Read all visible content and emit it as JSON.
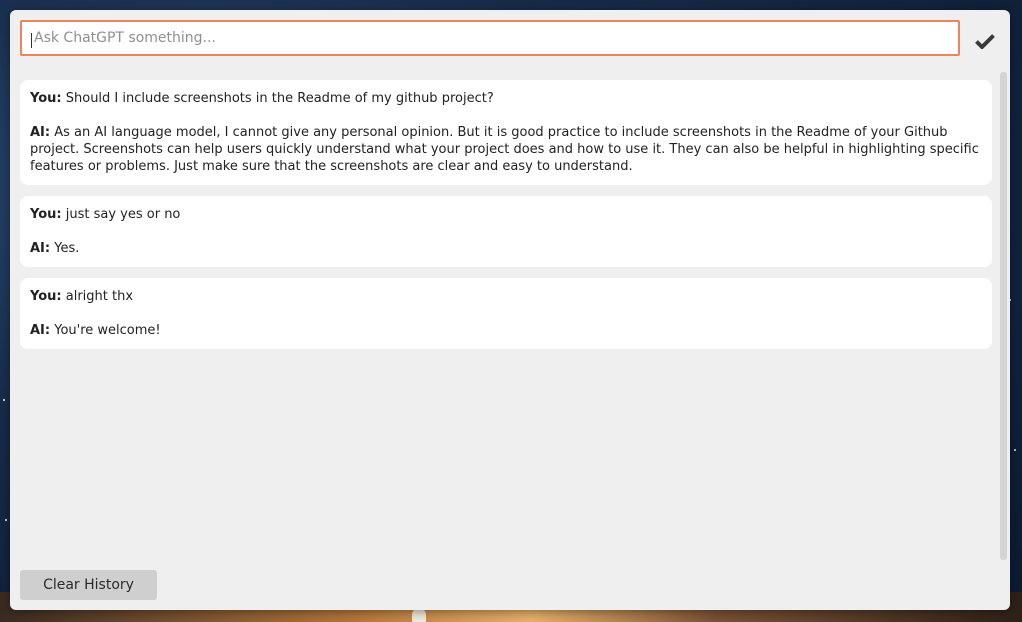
{
  "input": {
    "value": "",
    "placeholder": "Ask ChatGPT something..."
  },
  "submit": {
    "icon": "checkmark-icon"
  },
  "speakers": {
    "user": "You:",
    "ai": "AI:"
  },
  "messages": [
    {
      "user": "Should I include screenshots in the Readme of my github project?",
      "ai": "As an AI language model, I cannot give any personal opinion. But it is good practice to include screenshots in the Readme of your Github project. Screenshots can help users quickly understand what your project does and how to use it. They can also be helpful in highlighting specific features or problems. Just make sure that the screenshots are clear and easy to understand."
    },
    {
      "user": "just say yes or no",
      "ai": "Yes."
    },
    {
      "user": "alright thx",
      "ai": "You're welcome!"
    }
  ],
  "actions": {
    "clear_label": "Clear History"
  },
  "colors": {
    "input_border": "#e9865c",
    "window_bg": "#efefef",
    "card_bg": "#ffffff",
    "button_bg": "#cfcfcf"
  }
}
